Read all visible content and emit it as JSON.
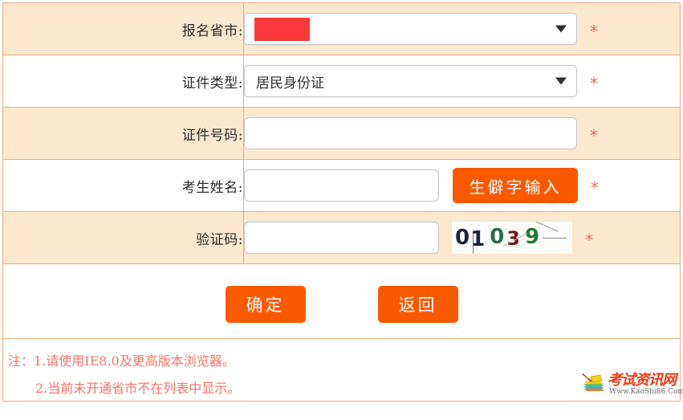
{
  "form": {
    "rows": [
      {
        "label": "报名省市:",
        "field_type": "select",
        "value": "",
        "redacted": true,
        "required_mark": "*"
      },
      {
        "label": "证件类型:",
        "field_type": "select",
        "value": "居民身份证",
        "redacted": false,
        "required_mark": "*"
      },
      {
        "label": "证件号码:",
        "field_type": "text",
        "value": "",
        "placeholder": "",
        "required_mark": "*"
      },
      {
        "label": "考生姓名:",
        "field_type": "text-with-button",
        "value": "",
        "placeholder": "",
        "button_label": "生僻字输入",
        "required_mark": "*"
      },
      {
        "label": "验证码:",
        "field_type": "text-with-captcha",
        "value": "",
        "placeholder": "",
        "captcha_text": "01039",
        "captcha_chars": [
          "0",
          "1",
          "0",
          "3",
          "9"
        ],
        "required_mark": "*"
      }
    ],
    "actions": {
      "submit_label": "确定",
      "back_label": "返回"
    }
  },
  "notes": {
    "line1": "注：1.请使用IE8.0及更高版本浏览器。",
    "line2": "2.当前未开通省市不在列表中显示。"
  },
  "watermark": {
    "title": "考试资讯网",
    "url": "Www.KaoShi86.Com"
  },
  "colors": {
    "row_shade": "#fce8ce",
    "border": "#eeab7d",
    "button_orange": "#fb5900",
    "required_star": "#f2645a",
    "note_text": "#f4756b",
    "redacted_block": "#fa3a3a",
    "watermark_title": "#ee3b12"
  }
}
